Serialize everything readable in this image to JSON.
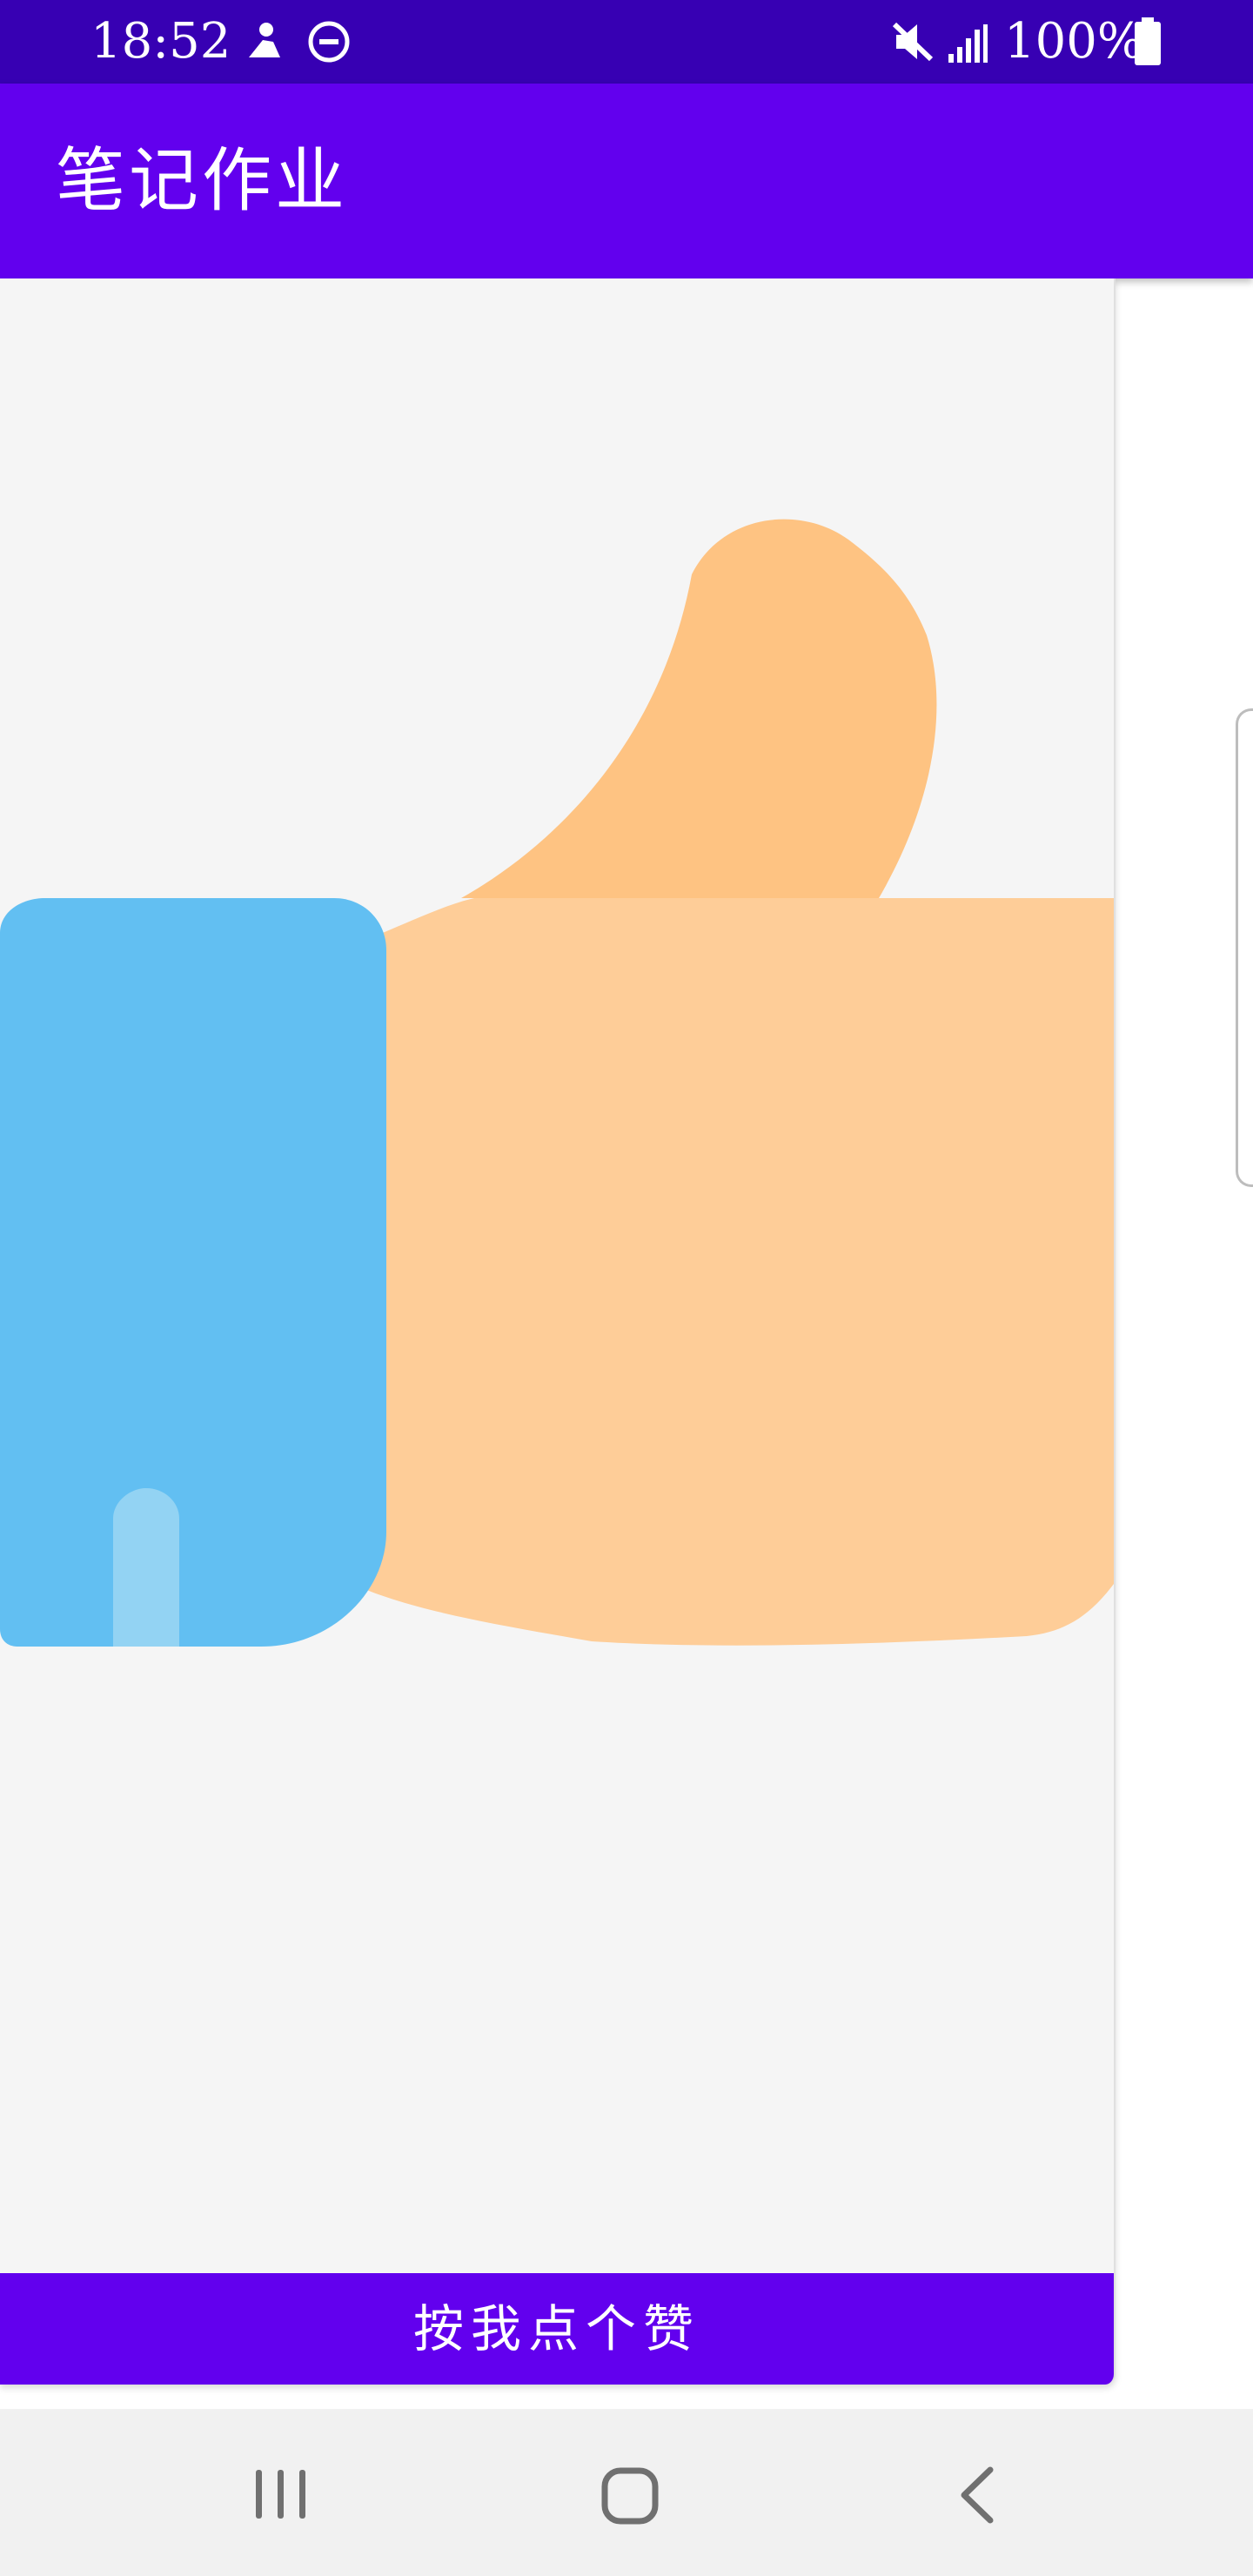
{
  "status_bar": {
    "time": "18:52",
    "battery_percent": "100%",
    "icons": [
      "notification-icon",
      "do-not-disturb-icon",
      "mute-icon",
      "signal-icon",
      "battery-icon"
    ],
    "background": "#3700b3"
  },
  "app_bar": {
    "title": "笔记作业",
    "background": "#6200ee"
  },
  "card": {
    "image": "thumbs-up-illustration",
    "colors": {
      "sleeve": "#62bff2",
      "hand": "#fecd98",
      "thumb": "#fec382",
      "card_bg": "#f5f5f5"
    }
  },
  "like_button": {
    "label": "按我点个赞",
    "background": "#6200ee"
  },
  "nav_bar": {
    "icons": [
      "recent-apps-icon",
      "home-icon",
      "back-icon"
    ]
  }
}
